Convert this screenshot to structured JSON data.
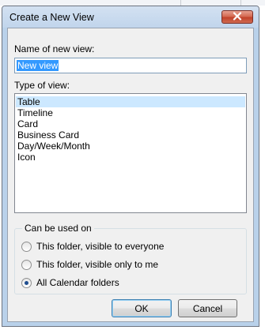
{
  "dialog": {
    "title": "Create a New View",
    "close_icon": "close-icon"
  },
  "name_field": {
    "label": "Name of new view:",
    "value": "New view"
  },
  "type_list": {
    "label": "Type of view:",
    "items": [
      "Table",
      "Timeline",
      "Card",
      "Business Card",
      "Day/Week/Month",
      "Icon"
    ],
    "selected": "Table"
  },
  "can_be_used_on": {
    "label": "Can be used on",
    "options": [
      {
        "label": "This folder, visible to everyone",
        "checked": false
      },
      {
        "label": "This folder, visible only to me",
        "checked": false
      },
      {
        "label": "All Calendar folders",
        "checked": true
      }
    ]
  },
  "buttons": {
    "ok": "OK",
    "cancel": "Cancel"
  },
  "colors": {
    "selection": "#3399ff",
    "list_selected": "#cce8ff",
    "close_button": "#c94b30"
  }
}
